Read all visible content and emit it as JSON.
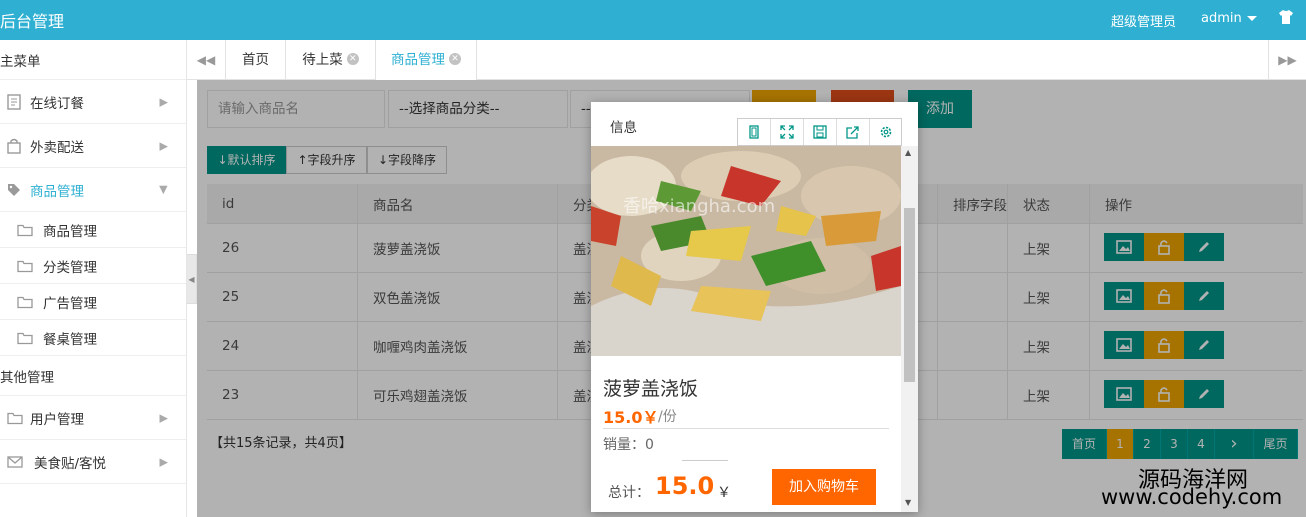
{
  "header": {
    "title": "后台管理",
    "role": "超级管理员",
    "user": "admin",
    "bg_color": "#2fb0d2"
  },
  "sidebar": {
    "main_menu": "主菜单",
    "items": [
      {
        "label": "在线订餐",
        "icon": "document-icon"
      },
      {
        "label": "外卖配送",
        "icon": "bag-icon"
      },
      {
        "label": "商品管理",
        "icon": "tag-icon"
      },
      {
        "label": "商品管理",
        "icon": "folder-icon"
      },
      {
        "label": "分类管理",
        "icon": "folder-icon"
      },
      {
        "label": "广告管理",
        "icon": "folder-icon"
      },
      {
        "label": "餐桌管理",
        "icon": "folder-icon"
      }
    ],
    "other_menu": "其他管理",
    "other_items": [
      {
        "label": "用户管理",
        "icon": "folder-icon"
      },
      {
        "label": "美食贴/客悦",
        "icon": "mail-icon"
      }
    ]
  },
  "tabs": [
    {
      "label": "首页"
    },
    {
      "label": "待上菜"
    },
    {
      "label": "商品管理"
    }
  ],
  "toolbar": {
    "search_placeholder": "请输入商品名",
    "category_select": "--选择商品分类--",
    "second_select": "--",
    "add_label": "添加",
    "colors": {
      "yellow": "#f0a500",
      "red": "#e04e1b",
      "green": "#009688"
    }
  },
  "sort": {
    "default": "默认排序",
    "asc": "字段升序",
    "desc": "字段降序"
  },
  "table": {
    "headers": [
      "id",
      "商品名",
      "分类",
      "排序字段",
      "状态",
      "操作"
    ],
    "rows": [
      {
        "id": "26",
        "name": "菠萝盖浇饭",
        "category": "盖浇",
        "status": "上架"
      },
      {
        "id": "25",
        "name": "双色盖浇饭",
        "category": "盖浇",
        "status": "上架"
      },
      {
        "id": "24",
        "name": "咖喱鸡肉盖浇饭",
        "category": "盖浇",
        "status": "上架"
      },
      {
        "id": "23",
        "name": "可乐鸡翅盖浇饭",
        "category": "盖浇",
        "status": "上架"
      }
    ]
  },
  "summary": "【共15条记录，共4页】",
  "pager": {
    "first": "首页",
    "pages": [
      "1",
      "2",
      "3",
      "4"
    ],
    "next": "›",
    "last": "尾页",
    "current": "1"
  },
  "popup": {
    "title": "信息",
    "image_watermark": "香哈xiangha.com",
    "dish_name": "菠萝盖浇饭",
    "price": "15.0￥",
    "unit": "/份",
    "sales": "销量：0",
    "total_label": "总计：",
    "total_value": "15.0",
    "currency": "￥",
    "cart_label": "加入购物车"
  },
  "watermark": {
    "line1": "源码海洋网",
    "line2": "www.codehy.com"
  }
}
